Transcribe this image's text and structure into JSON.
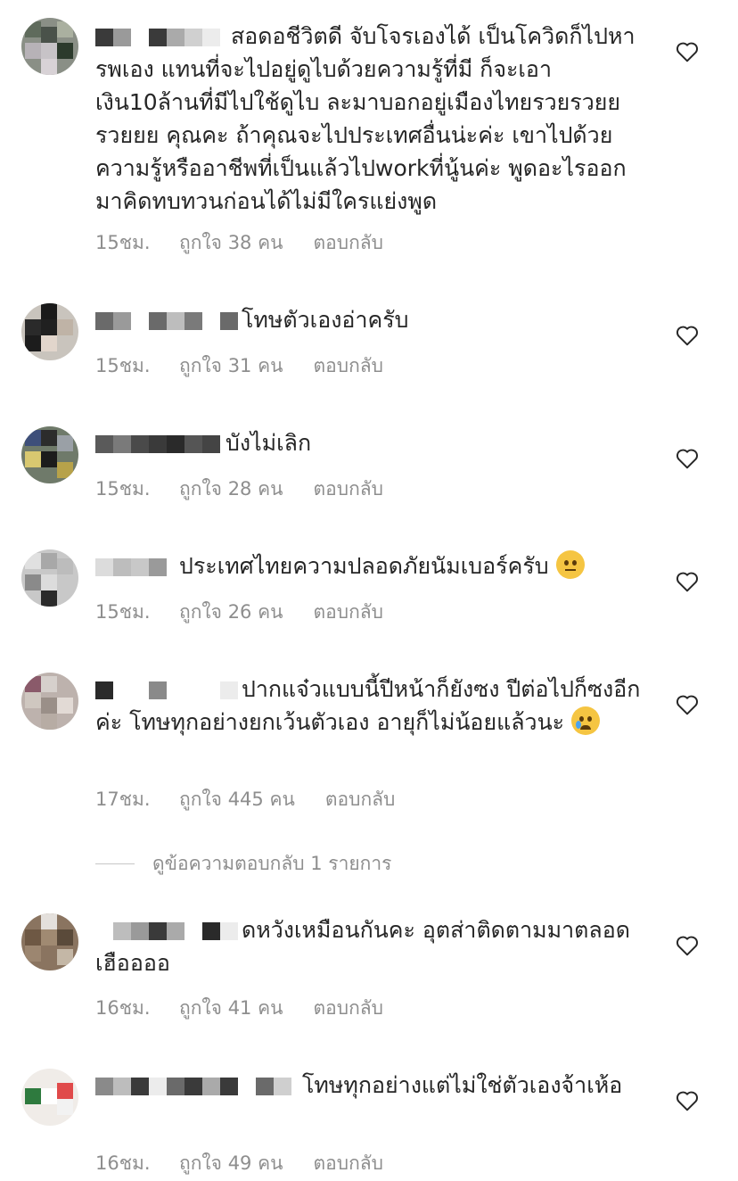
{
  "labels": {
    "like_prefix": "ถูกใจ",
    "like_suffix": "คน",
    "reply": "ตอบกลับ"
  },
  "comments": [
    {
      "text": "สอดอชีวิตดี จับโจรเองได้ เป็นโควิดก็ไปหารพเอง แทนที่จะไปอยู่ดูไบด้วยความรู้ที่มี ก็จะเอาเงิน10ล้านที่มีไปใช้ดูไบ ละมาบอกอยู่เมืองไทยรวยรวยย รวยยย คุณคะ ถ้าคุณจะไปประเทศอื่นน่ะค่ะ เขาไปด้วยความรู้หรืออาชีพที่เป็นแล้วไปworkที่นู้นค่ะ พูดอะไรออกมาคิดทบทวนก่อนได้ไม่มีใครแย่งพูด",
      "time": "15ชม.",
      "likes": "38"
    },
    {
      "text": "โทษตัวเองอ่าครับ",
      "time": "15ชม.",
      "likes": "31"
    },
    {
      "text": "บังไม่เลิก",
      "time": "15ชม.",
      "likes": "28"
    },
    {
      "text": "ประเทศไทยความปลอดภัยนัมเบอร์ครับ",
      "time": "15ชม.",
      "likes": "26",
      "emoji": "face-with-raised-eyebrow-icon"
    },
    {
      "text": "ปากแจ๋วแบบนี้ปีหน้าก็ยังซง ปีต่อไปก็ซงอีกค่ะ โทษทุกอย่างยกเว้นตัวเอง อายุก็ไม่น้อยแล้วนะ",
      "time": "17ชม.",
      "likes": "445",
      "emoji": "crying-face-icon"
    },
    {
      "text": "ดหวังเหมือนกันคะ อุตส่าติดตามมาตลอด เฮืออออ",
      "time": "16ชม.",
      "likes": "41"
    },
    {
      "text": "โทษทุกอย่างแต่ไม่ใช่ตัวเองจ้าเห้อ",
      "time": "16ชม.",
      "likes": "49"
    }
  ],
  "view_replies": "ดูข้อความตอบกลับ 1 รายการ",
  "colors": {
    "text": "#262626",
    "meta": "#8e8e8e",
    "icon": "#262626"
  }
}
